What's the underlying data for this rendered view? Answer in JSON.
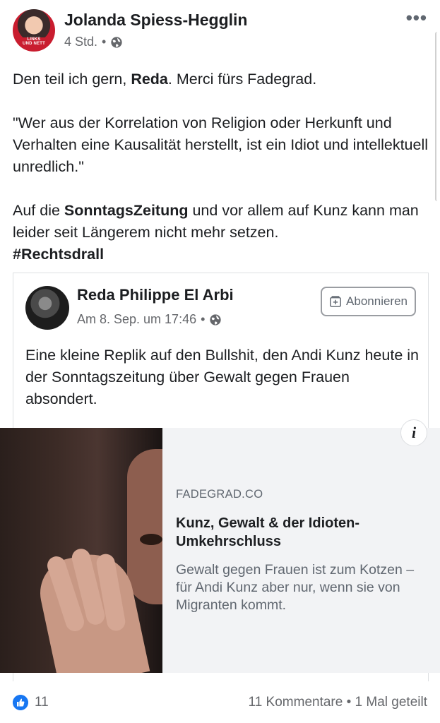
{
  "post": {
    "author": "Jolanda Spiess-Hegglin",
    "avatar_badge": "LINKS UND NETT",
    "time": "4 Std.",
    "separator": "•",
    "privacy_icon": "globe-icon",
    "more_label": "•••",
    "paragraph1": {
      "before": "Den teil ich gern, ",
      "bold": "Reda",
      "after": ". Merci fürs Fadegrad."
    },
    "paragraph2": "\"Wer aus der Korrelation von Religion oder Herkunft und Verhalten eine Kausalität herstellt, ist ein Idiot und intellektuell unredlich.\"",
    "paragraph3": {
      "part1": "Auf die ",
      "bold1": "SonntagsZeitung",
      "part2": " und vor allem auf Kunz kann man leider seit Längerem nicht mehr setzen.",
      "hashtag": "#Rechtsdrall"
    }
  },
  "shared": {
    "author": "Reda Philippe El Arbi",
    "time": "Am 8. Sep. um 17:46",
    "separator": "•",
    "follow_label": "Abonnieren",
    "text": "Eine kleine Replik auf den Bullshit, den Andi Kunz heute in der Sonntagszeitung über Gewalt gegen Frauen absondert."
  },
  "link_card": {
    "info_label": "i",
    "domain": "FADEGRAD.CO",
    "title": "Kunz, Gewalt & der Idioten-Umkehrschluss",
    "description": "Gewalt gegen Frauen ist zum Kotzen – für Andi Kunz aber nur, wenn sie von Migranten kommt."
  },
  "footer": {
    "likes": "11",
    "comments": "11 Kommentare",
    "separator": "•",
    "shares": "1 Mal geteilt"
  },
  "colors": {
    "primary_text": "#1c1e21",
    "secondary_text": "#65676b",
    "like_blue": "#1877f2",
    "card_bg": "#f2f3f5"
  }
}
